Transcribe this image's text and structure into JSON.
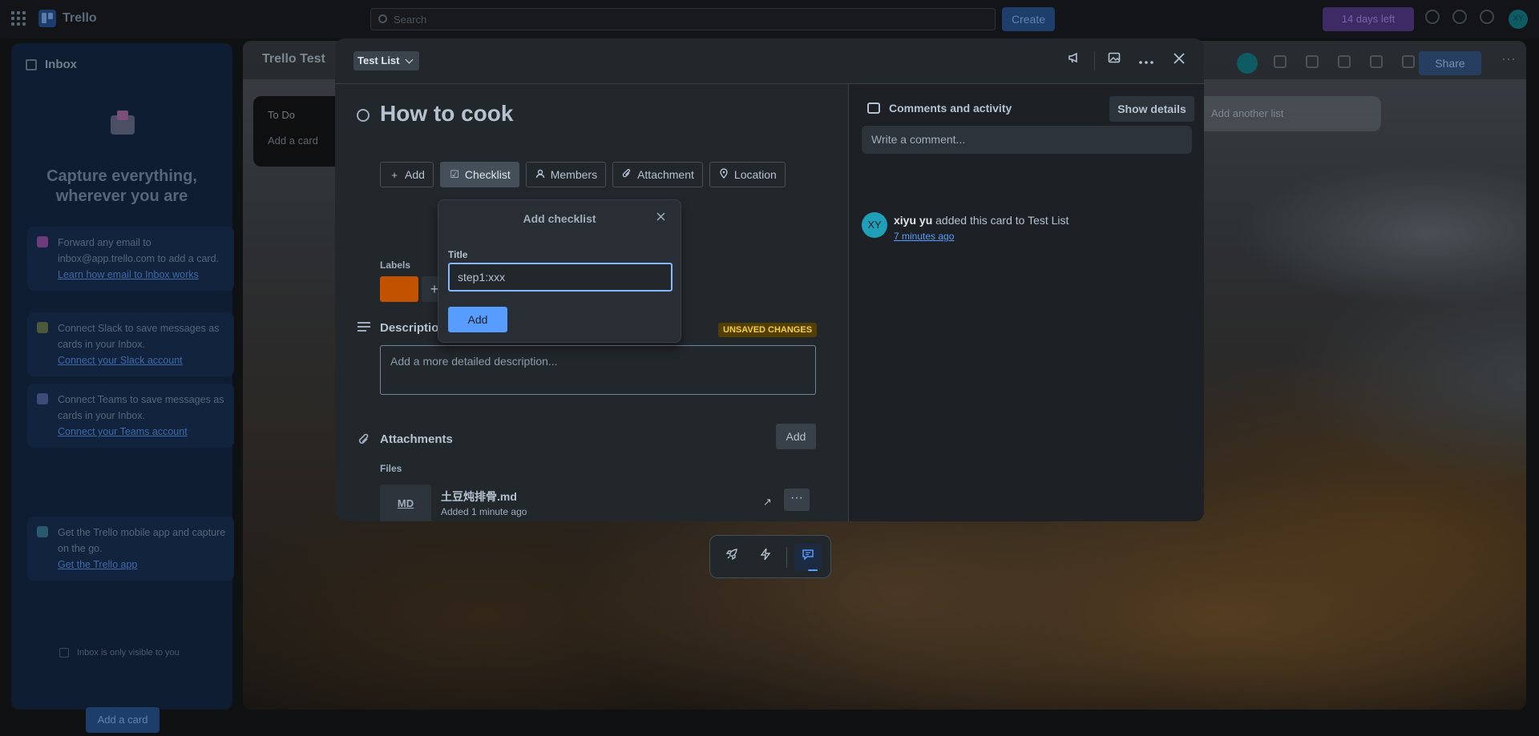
{
  "topbar": {
    "app_name": "Trello",
    "search_placeholder": "Search",
    "create_label": "Create",
    "trial_label": "14 days left",
    "avatar_initials": "XY"
  },
  "inbox": {
    "title": "Inbox",
    "headline": "Capture everything, wherever you are",
    "tips": [
      {
        "text": "Forward any email to inbox@app.trello.com to add a card.",
        "link": "Learn how email to Inbox works"
      },
      {
        "text": "Connect Slack to save messages as cards in your Inbox.",
        "link": "Connect your Slack account"
      },
      {
        "text": "Connect Teams to save messages as cards in your Inbox.",
        "link": "Connect your Teams account"
      },
      {
        "text": "Get the Trello mobile app and capture on the go.",
        "link": "Get the Trello app"
      }
    ],
    "visibility_note": "Inbox is only visible to you",
    "add_card_label": "Add a card"
  },
  "board": {
    "title": "Trello Test",
    "list_name": "To Do",
    "add_card_label": "Add a card",
    "add_list_label": "Add another list",
    "share_label": "Share"
  },
  "card": {
    "list_name": "Test List",
    "title": "How to cook",
    "actions": {
      "add": "Add",
      "checklist": "Checklist",
      "members": "Members",
      "attachment": "Attachment",
      "location": "Location"
    },
    "labels_heading": "Labels",
    "label_color": "#c25100",
    "description_heading": "Description",
    "unsaved_badge": "UNSAVED CHANGES",
    "description_placeholder": "Add a more detailed description...",
    "attachments_heading": "Attachments",
    "attachments_add": "Add",
    "files_heading": "Files",
    "file": {
      "type": "MD",
      "name": "土豆炖排骨.md",
      "meta": "Added 1 minute ago"
    }
  },
  "checklist_popover": {
    "title": "Add checklist",
    "field_label": "Title",
    "field_value": "step1:xxx",
    "add_label": "Add"
  },
  "activity": {
    "heading": "Comments and activity",
    "show_details": "Show details",
    "comment_placeholder": "Write a comment...",
    "avatar_initials": "XY",
    "user": "xiyu yu",
    "action": "added this card to Test List",
    "time": "7 minutes ago"
  },
  "colors": {
    "accent": "#579dff",
    "modal_bg": "#22272b",
    "unsaved_bg": "#533f04",
    "unsaved_text": "#f5cd47"
  }
}
